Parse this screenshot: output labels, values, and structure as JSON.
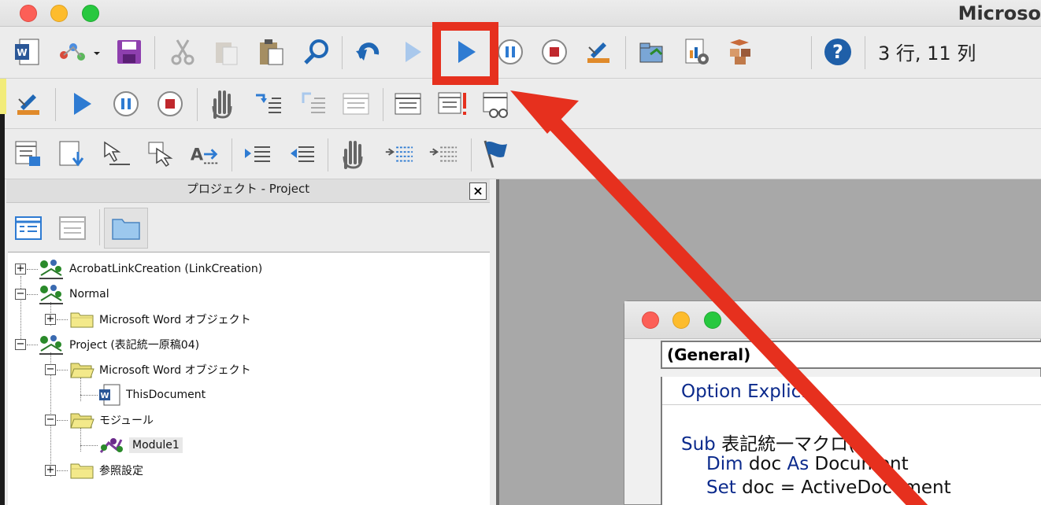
{
  "window": {
    "title": "Microso",
    "traffic_lights": {
      "close": "#fc5f57",
      "minimize": "#fdbc2d",
      "maximize": "#27c83f"
    }
  },
  "toolbar_standard": {
    "cursor_position": "3 行, 11 列",
    "icons": [
      "word-icon",
      "insert-icon",
      "save-icon",
      "cut-icon",
      "copy-icon",
      "paste-icon",
      "find-icon",
      "undo-icon",
      "redo-icon",
      "run-icon",
      "pause-icon",
      "stop-icon",
      "design-mode-icon",
      "project-explorer-icon",
      "properties-icon",
      "object-browser-icon",
      "help-icon"
    ]
  },
  "toolbar_debug": {
    "icons": [
      "design-mode-icon",
      "run-icon",
      "pause-icon",
      "stop-icon",
      "toggle-breakpoint-icon",
      "step-into-icon",
      "step-over-icon",
      "step-out-icon",
      "locals-window-icon",
      "immediate-window-icon",
      "watch-window-icon",
      "quick-watch-icon"
    ]
  },
  "toolbar_edit": {
    "icons": [
      "list-properties-icon",
      "list-constants-icon",
      "quick-info-icon",
      "parameter-info-icon",
      "complete-word-icon",
      "indent-icon",
      "outdent-icon",
      "toggle-breakpoint-icon",
      "comment-block-icon",
      "uncomment-block-icon",
      "toggle-bookmark-icon"
    ]
  },
  "project_panel": {
    "title": "プロジェクト - Project",
    "close_label": "×",
    "tree": [
      {
        "label": "AcrobatLinkCreation (LinkCreation)",
        "expander": "+",
        "icon": "vba-project-icon"
      },
      {
        "label": "Normal",
        "expander": "−",
        "icon": "vba-project-icon"
      },
      {
        "label": "Microsoft Word オブジェクト",
        "expander": "+",
        "icon": "folder-icon"
      },
      {
        "label": "Project (表記統一原稿04)",
        "expander": "−",
        "icon": "vba-project-icon"
      },
      {
        "label": "Microsoft Word オブジェクト",
        "expander": "−",
        "icon": "folder-open-icon"
      },
      {
        "label": "ThisDocument",
        "expander": "",
        "icon": "word-document-icon"
      },
      {
        "label": "モジュール",
        "expander": "−",
        "icon": "folder-open-icon"
      },
      {
        "label": "Module1",
        "expander": "",
        "icon": "module-icon"
      },
      {
        "label": "参照設定",
        "expander": "+",
        "icon": "folder-icon"
      }
    ]
  },
  "code_window": {
    "object_combo": "(General)",
    "lines": [
      {
        "kw": "Option Explicit",
        "text": ""
      },
      {
        "kw": "Sub",
        "text": " 表記統一マクロ()"
      },
      {
        "kw": "Dim",
        "text": " doc ",
        "kw2": "As",
        "text2": " Document"
      },
      {
        "kw": "Set",
        "text": " doc = ActiveDocument"
      }
    ]
  },
  "annotation": {
    "color": "#e6301e"
  }
}
